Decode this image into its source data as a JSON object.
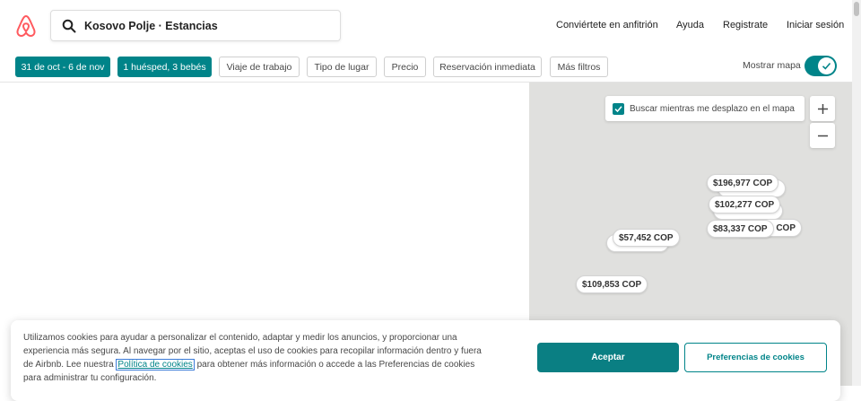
{
  "header": {
    "search_text": "Kosovo Polje · Estancias",
    "nav": [
      "Conviértete en anfitrión",
      "Ayuda",
      "Registrate",
      "Iniciar sesión"
    ]
  },
  "filters": {
    "dates": "31 de oct - 6 de nov",
    "guests": "1 huésped, 3 bebés",
    "work_trip": "Viaje de trabajo",
    "place_type": "Tipo de lugar",
    "price": "Precio",
    "instant_book": "Reservación inmediata",
    "more_filters": "Más filtros",
    "show_map": "Mostrar mapa"
  },
  "map": {
    "search_as_move": "Buscar mientras me desplazo en el mapa",
    "prices": [
      "$196,977 COP",
      "$102,277 COP",
      "$83,337 COP",
      "$57,452 COP",
      "$109,853 COP"
    ],
    "partial_text": "COP"
  },
  "cookie": {
    "text_before": "Utilizamos cookies para ayudar a personalizar el contenido, adaptar y medir los anuncios, y proporcionar una experiencia más segura. Al navegar por el sitio, aceptas el uso de cookies para recopilar información dentro y fuera de Airbnb. Lee nuestra ",
    "link": "Política de cookies",
    "text_after": " para obtener más información o accede a las Preferencias de cookies para administrar tu configuración.",
    "accept": "Aceptar",
    "preferences": "Preferencias de cookies"
  },
  "colors": {
    "accent": "#008489",
    "brand": "#FF5A5F",
    "map_bg": "#e0e0de"
  },
  "icons": [
    "airbnb-logo",
    "search-icon",
    "check-icon",
    "plus-icon",
    "minus-icon"
  ]
}
